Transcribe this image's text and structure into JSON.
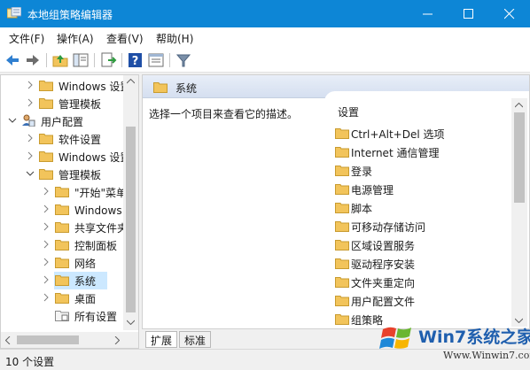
{
  "window": {
    "title": "本地组策略编辑器",
    "controls": [
      "minimize-icon",
      "maximize-icon",
      "close-icon"
    ]
  },
  "menu": [
    {
      "label": "文件(F)"
    },
    {
      "label": "操作(A)"
    },
    {
      "label": "查看(V)"
    },
    {
      "label": "帮助(H)"
    }
  ],
  "toolbar": {
    "icons": [
      "back-arrow-icon",
      "forward-arrow-icon",
      "up-folder-icon",
      "show-hide-tree-icon",
      "export-list-icon",
      "help-icon",
      "properties-icon",
      "filter-icon"
    ]
  },
  "tree": {
    "items": [
      {
        "label": "Windows 设置",
        "expanded": false
      },
      {
        "label": "管理模板",
        "expanded": false
      },
      {
        "label": "用户配置",
        "expanded": true
      },
      {
        "label": "软件设置",
        "expanded": false
      },
      {
        "label": "Windows 设置",
        "expanded": false
      },
      {
        "label": "管理模板",
        "expanded": true
      },
      {
        "label": "\"开始\"菜单和任务栏",
        "expanded": false
      },
      {
        "label": "Windows 组件",
        "expanded": false
      },
      {
        "label": "共享文件夹",
        "expanded": false
      },
      {
        "label": "控制面板",
        "expanded": false
      },
      {
        "label": "网络",
        "expanded": false
      },
      {
        "label": "系统",
        "expanded": false,
        "selected": true
      },
      {
        "label": "桌面",
        "expanded": false
      },
      {
        "label": "所有设置",
        "expanded": false
      }
    ]
  },
  "main": {
    "header_title": "系统",
    "description": "选择一个项目来查看它的描述。",
    "settings_header": "设置",
    "settings": [
      {
        "label": "Ctrl+Alt+Del 选项"
      },
      {
        "label": "Internet 通信管理"
      },
      {
        "label": "登录"
      },
      {
        "label": "电源管理"
      },
      {
        "label": "脚本"
      },
      {
        "label": "可移动存储访问"
      },
      {
        "label": "区域设置服务"
      },
      {
        "label": "驱动程序安装"
      },
      {
        "label": "文件夹重定向"
      },
      {
        "label": "用户配置文件"
      },
      {
        "label": "组策略"
      }
    ]
  },
  "tabs": [
    {
      "label": "扩展",
      "active": true
    },
    {
      "label": "标准",
      "active": false
    }
  ],
  "status": {
    "text": "10 个设置"
  },
  "watermark": {
    "title": "Win7系统之家",
    "url": "Www.Winwin7.com"
  },
  "colors": {
    "titlebar": "#0d86d6",
    "selection": "#cce8ff",
    "folder": "#f2c45b",
    "watermark_blue": "#1f5fae"
  }
}
